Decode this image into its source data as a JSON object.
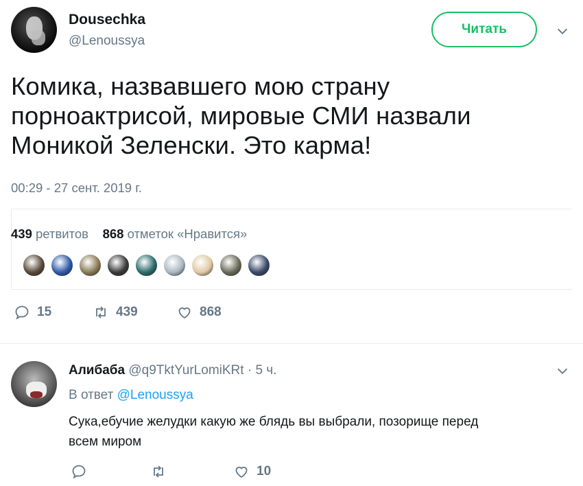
{
  "main_tweet": {
    "author_name": "Dousechka",
    "author_handle": "@Lenoussya",
    "follow_label": "Читать",
    "text_lines": [
      "Комика, назвавшего мою страну",
      "порноактрисой, мировые СМИ назвали",
      "Моникой Зеленски. Это карма!"
    ],
    "timestamp": "00:29 - 27 сент. 2019 г.",
    "stats": {
      "retweets_count": "439",
      "retweets_label": "ретвитов",
      "likes_count": "868",
      "likes_label": "отметок «Нравится»"
    },
    "liker_avatars": [
      "#5a4a3a",
      "#2e5aa8",
      "#8a7b57",
      "#3b3b3b",
      "#2c6b6b",
      "#aab8c2",
      "#e0c9a6",
      "#6b6b5a",
      "#3a4a6b"
    ],
    "actions": {
      "replies": "15",
      "retweets": "439",
      "likes": "868"
    }
  },
  "reply": {
    "author_name": "Алибаба",
    "author_handle": "@q9TktYurLomiKRt",
    "separator": "·",
    "time": "5 ч.",
    "reply_prefix": "В ответ",
    "reply_to": "@Lenoussya",
    "text_lines": [
      "Сука,ебучие желудки какую же блядь вы выбрали, позорище перед",
      "всем миром"
    ],
    "actions": {
      "likes": "10"
    }
  },
  "colors": {
    "accent_green": "#17bf63",
    "link_blue": "#1da1f2",
    "muted": "#657786"
  }
}
